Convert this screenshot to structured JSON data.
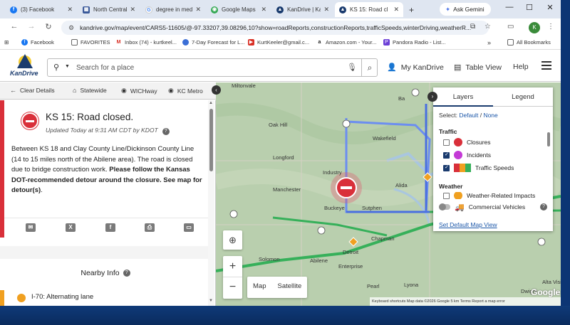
{
  "browser": {
    "tabs": [
      {
        "title": "(3) Facebook",
        "color": "#1877f2",
        "glyph": "f"
      },
      {
        "title": "North Central",
        "color": "#3b5a9a",
        "glyph": "▦"
      },
      {
        "title": "degree in med",
        "color": "#4285f4",
        "glyph": "G"
      },
      {
        "title": "Google Maps",
        "color": "#34a853",
        "glyph": "◉"
      },
      {
        "title": "KanDrive | Kan",
        "color": "#1a3b6e",
        "glyph": "▲"
      },
      {
        "title": "KS 15: Road cl",
        "color": "#1a3b6e",
        "glyph": "▲"
      }
    ],
    "new_tab": "+",
    "ask_gemini": "Ask Gemini",
    "url": "kandrive.gov/map/event/CARS5-11605/@-97.33207,39.08296,10?show=roadReports,constructionReports,trafficSpeeds,winterDriving,weatherR...",
    "profile_initial": "K",
    "bookmarks": [
      {
        "label": "Facebook",
        "color": "#1877f2"
      },
      {
        "label": "FAVORITES",
        "color": "#666"
      },
      {
        "label": "Inbox (74) - kurtkeel...",
        "color": "#d93025"
      },
      {
        "label": "7-Day Forecast for L...",
        "color": "#3b6fd6"
      },
      {
        "label": "KurtKeeler@gmail.c...",
        "color": "#d93025"
      },
      {
        "label": "Amazon.com - Your...",
        "color": "#222"
      },
      {
        "label": "Pandora Radio - List...",
        "color": "#6b3fd6"
      }
    ],
    "all_bookmarks": "All Bookmarks",
    "bookmark_overflow": "»"
  },
  "header": {
    "logo_text": "KanDrive",
    "search_placeholder": "Search for a place",
    "my_kandrive": "My KanDrive",
    "table_view": "Table View",
    "help": "Help"
  },
  "subnav": {
    "clear": "Clear Details",
    "statewide": "Statewide",
    "wichway": "WICHway",
    "kcmetro": "KC Metro"
  },
  "event": {
    "title": "KS 15: Road closed.",
    "updated": "Updated Today at 9:31 AM CDT by KDOT",
    "body_plain": "Between KS 18 and Clay County Line/Dickinson County Line (14 to 15 miles north of the Abilene area). The road is closed due to bridge construction work. ",
    "body_bold": "Please follow the Kansas DOT-recommended detour around the closure. See map for detour(s)",
    "body_end": "."
  },
  "nearby": {
    "heading": "Nearby Info",
    "first_item": "I-70: Alternating lane"
  },
  "map": {
    "labels": [
      "Miltonvale",
      "Oak Hill",
      "Longford",
      "Industry",
      "Manchester",
      "Buckeye",
      "Sutphen",
      "Wakefield",
      "Alida",
      "Chapman",
      "Detroit",
      "Solomon",
      "Abilene",
      "Enterprise",
      "Pearl",
      "Lyona",
      "Alta Visi",
      "Dwight",
      "Ba"
    ],
    "map_btn": "Map",
    "satellite_btn": "Satellite",
    "attribution": "Keyboard shortcuts   Map data ©2026 Google   5 km         Terms   Report a map error",
    "google": "Google"
  },
  "layers": {
    "tab_layers": "Layers",
    "tab_legend": "Legend",
    "select_label": "Select:",
    "select_default": "Default",
    "select_sep": "/",
    "select_none": "None",
    "traffic_heading": "Traffic",
    "closures": "Closures",
    "incidents": "Incidents",
    "traffic_speeds": "Traffic Speeds",
    "weather_heading": "Weather",
    "weather_impacts": "Weather-Related Impacts",
    "commercial": "Commercial Vehicles",
    "default_view": "Set Default Map View"
  }
}
